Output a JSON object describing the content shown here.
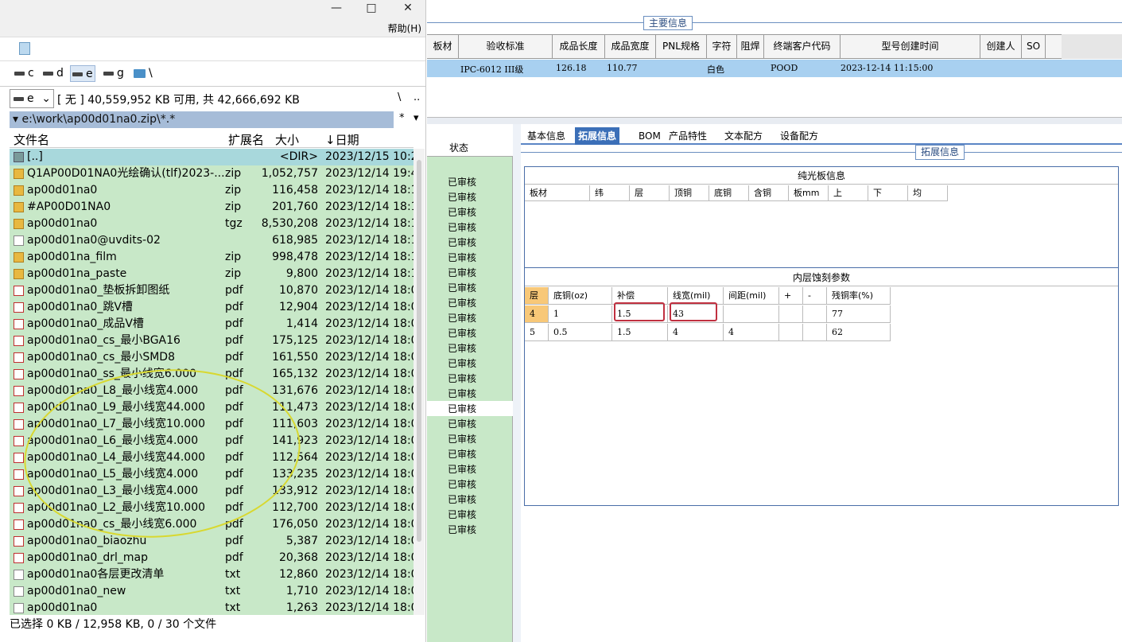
{
  "window": {
    "minimize_glyph": "—",
    "maximize_glyph": "□",
    "close_glyph": "✕"
  },
  "menu": {
    "help": "帮助(H)"
  },
  "drives": [
    {
      "label": "c",
      "selected": false
    },
    {
      "label": "d",
      "selected": false
    },
    {
      "label": "e",
      "selected": true
    },
    {
      "label": "g",
      "selected": false
    },
    {
      "label": "\\",
      "selected": false
    }
  ],
  "drive_combo": {
    "value": "e"
  },
  "free_space": "[ 无 ]  40,559,952 KB 可用,  共 42,666,692 KB",
  "free_right": {
    "root": "\\",
    "up": ".."
  },
  "path": "e:\\work\\ap00d01na0.zip\\*.*",
  "path_right": {
    "star": "*",
    "arrow": "▾"
  },
  "columns": {
    "name": "文件名",
    "ext": "扩展名",
    "size": "大小",
    "date": "↓日期"
  },
  "files": [
    {
      "name": "[..]",
      "ext": "",
      "size": "<DIR>",
      "date": "2023/12/15 10:24",
      "icon": "up"
    },
    {
      "name": "Q1AP00D01NA0光绘确认(tlf)2023-...",
      "ext": "zip",
      "size": "1,052,757",
      "date": "2023/12/14 19:42",
      "icon": "zip"
    },
    {
      "name": "ap00d01na0",
      "ext": "zip",
      "size": "116,458",
      "date": "2023/12/14 18:12",
      "icon": "zip"
    },
    {
      "name": "#AP00D01NA0",
      "ext": "zip",
      "size": "201,760",
      "date": "2023/12/14 18:12",
      "icon": "zip"
    },
    {
      "name": "ap00d01na0",
      "ext": "tgz",
      "size": "8,530,208",
      "date": "2023/12/14 18:12",
      "icon": "zip"
    },
    {
      "name": "ap00d01na0@uvdits-02",
      "ext": "",
      "size": "618,985",
      "date": "2023/12/14 18:1",
      "icon": "txt"
    },
    {
      "name": "ap00d01na_film",
      "ext": "zip",
      "size": "998,478",
      "date": "2023/12/14 18:1",
      "icon": "zip"
    },
    {
      "name": "ap00d01na_paste",
      "ext": "zip",
      "size": "9,800",
      "date": "2023/12/14 18:1",
      "icon": "zip"
    },
    {
      "name": "ap00d01na0_垫板拆卸图纸",
      "ext": "pdf",
      "size": "10,870",
      "date": "2023/12/14 18:07",
      "icon": "pdf"
    },
    {
      "name": "ap00d01na0_跳V槽",
      "ext": "pdf",
      "size": "12,904",
      "date": "2023/12/14 18:07",
      "icon": "pdf"
    },
    {
      "name": "ap00d01na0_成品V槽",
      "ext": "pdf",
      "size": "1,414",
      "date": "2023/12/14 18:07",
      "icon": "pdf"
    },
    {
      "name": "ap00d01na0_cs_最小BGA16",
      "ext": "pdf",
      "size": "175,125",
      "date": "2023/12/14 18:07",
      "icon": "pdf"
    },
    {
      "name": "ap00d01na0_cs_最小SMD8",
      "ext": "pdf",
      "size": "161,550",
      "date": "2023/12/14 18:07",
      "icon": "pdf"
    },
    {
      "name": "ap00d01na0_ss_最小线宽6.000",
      "ext": "pdf",
      "size": "165,132",
      "date": "2023/12/14 18:07",
      "icon": "pdf"
    },
    {
      "name": "ap00d01na0_L8_最小线宽4.000",
      "ext": "pdf",
      "size": "131,676",
      "date": "2023/12/14 18:06",
      "icon": "pdf"
    },
    {
      "name": "ap00d01na0_L9_最小线宽44.000",
      "ext": "pdf",
      "size": "111,473",
      "date": "2023/12/14 18:06",
      "icon": "pdf"
    },
    {
      "name": "ap00d01na0_L7_最小线宽10.000",
      "ext": "pdf",
      "size": "111,603",
      "date": "2023/12/14 18:06",
      "icon": "pdf"
    },
    {
      "name": "ap00d01na0_L6_最小线宽4.000",
      "ext": "pdf",
      "size": "141,923",
      "date": "2023/12/14 18:06",
      "icon": "pdf"
    },
    {
      "name": "ap00d01na0_L4_最小线宽44.000",
      "ext": "pdf",
      "size": "112,564",
      "date": "2023/12/14 18:06",
      "icon": "pdf"
    },
    {
      "name": "ap00d01na0_L5_最小线宽4.000",
      "ext": "pdf",
      "size": "133,235",
      "date": "2023/12/14 18:06",
      "icon": "pdf"
    },
    {
      "name": "ap00d01na0_L3_最小线宽4.000",
      "ext": "pdf",
      "size": "133,912",
      "date": "2023/12/14 18:06",
      "icon": "pdf"
    },
    {
      "name": "ap00d01na0_L2_最小线宽10.000",
      "ext": "pdf",
      "size": "112,700",
      "date": "2023/12/14 18:06",
      "icon": "pdf"
    },
    {
      "name": "ap00d01na0_cs_最小线宽6.000",
      "ext": "pdf",
      "size": "176,050",
      "date": "2023/12/14 18:06",
      "icon": "pdf"
    },
    {
      "name": "ap00d01na0_biaozhu",
      "ext": "pdf",
      "size": "5,387",
      "date": "2023/12/14 18:06",
      "icon": "pdf"
    },
    {
      "name": "ap00d01na0_drl_map",
      "ext": "pdf",
      "size": "20,368",
      "date": "2023/12/14 18:06",
      "icon": "pdf"
    },
    {
      "name": "ap00d01na0各层更改清单",
      "ext": "txt",
      "size": "12,860",
      "date": "2023/12/14 18:0",
      "icon": "txt"
    },
    {
      "name": "ap00d01na0_new",
      "ext": "txt",
      "size": "1,710",
      "date": "2023/12/14 18:0",
      "icon": "txt"
    },
    {
      "name": "ap00d01na0",
      "ext": "txt",
      "size": "1,263",
      "date": "2023/12/14 18:0",
      "icon": "txt"
    }
  ],
  "status": "已选择 0 KB / 12,958 KB,  0 / 30 个文件",
  "main_info": {
    "label": "主要信息",
    "headers": [
      "板材",
      "验收标准",
      "成品长度",
      "成品宽度",
      "PNL规格",
      "字符",
      "阻焊",
      "终端客户代码",
      "型号创建时间",
      "创建人",
      "SO"
    ],
    "row": [
      "",
      "IPC-6012 III级",
      "126.18",
      "110.77",
      "",
      "白色",
      "",
      "POOD",
      "2023-12-14 11:15:00",
      "",
      ""
    ]
  },
  "status_col": {
    "header": "状态",
    "value": "已审核",
    "count": 24
  },
  "tabs": [
    {
      "label": "基本信息",
      "active": false
    },
    {
      "label": "拓展信息",
      "active": true
    },
    {
      "label": "BOM",
      "active": false
    },
    {
      "label": "产品特性",
      "active": false
    },
    {
      "label": "文本配方",
      "active": false
    },
    {
      "label": "设备配方",
      "active": false
    }
  ],
  "ext_info": {
    "label": "拓展信息",
    "plain": {
      "title": "纯光板信息",
      "headers": [
        "板材",
        "纬",
        "层",
        "顶铜",
        "底铜",
        "含铜",
        "板mm",
        "上",
        "下",
        "均"
      ]
    },
    "etch": {
      "title": "内层蚀刻参数",
      "headers": [
        "层",
        "底铜(oz)",
        "补偿",
        "线宽(mil)",
        "间距(mil)",
        "+",
        "-",
        "残铜率(%)"
      ],
      "rows": [
        [
          "4",
          "1",
          "1.5",
          "43",
          "",
          "",
          "",
          "77"
        ],
        [
          "5",
          "0.5",
          "1.5",
          "4",
          "4",
          "",
          "",
          "62"
        ]
      ]
    }
  }
}
